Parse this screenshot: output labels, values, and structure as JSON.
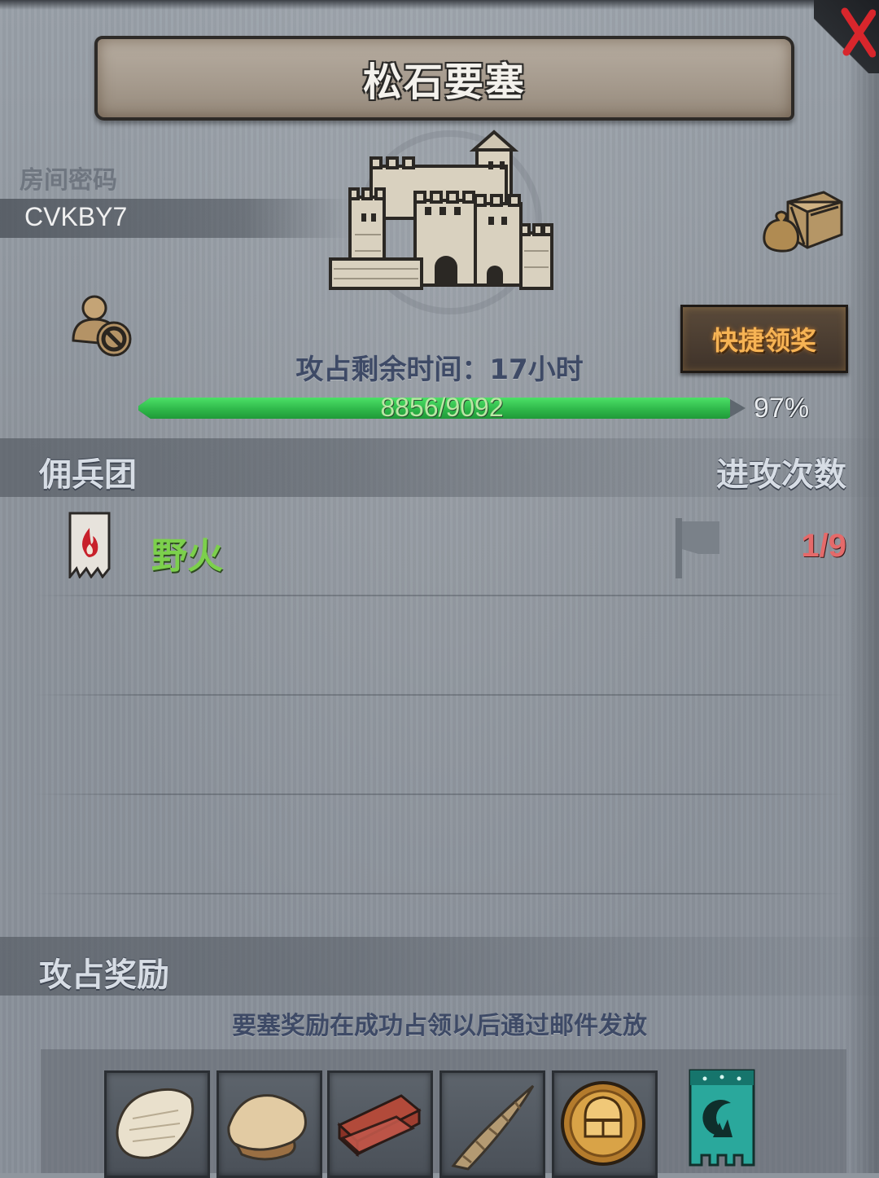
{
  "header": {
    "title": "松石要塞",
    "close_icon": "close-x-icon"
  },
  "room": {
    "label": "房间密码",
    "code": "CVKBY7"
  },
  "fortress": {
    "icon": "castle-icon",
    "loot_icon": "loot-sacks-crate-icon",
    "ban_icon": "user-ban-icon",
    "quick_claim_label": "快捷领奖",
    "time_label": "攻占剩余时间：",
    "time_value": "17小时",
    "progress_text": "8856/9092",
    "progress_fraction": 0.974,
    "progress_percent": "97%",
    "colors": {
      "progress_green": "#2fb84a",
      "quick_claim_text": "#f6b354",
      "guild_name": "#7cd04c",
      "attack_count": "#e56a6a"
    }
  },
  "mercenaries": {
    "header_left": "佣兵团",
    "header_right": "进攻次数",
    "rows": [
      {
        "banner_icon": "flame-banner-icon",
        "name": "野火",
        "flag_icon": "flag-icon",
        "attacks": "1/9"
      }
    ]
  },
  "rewards": {
    "header": "攻占奖励",
    "note": "要塞奖励在成功占领以后通过邮件发放",
    "items": [
      {
        "icon": "white-fur-pelt-icon"
      },
      {
        "icon": "tan-fur-pelt-icon"
      },
      {
        "icon": "wood-planks-icon"
      },
      {
        "icon": "horn-icon"
      },
      {
        "icon": "knight-helmet-coin-icon"
      },
      {
        "icon": "moon-guild-banner-icon"
      }
    ]
  }
}
